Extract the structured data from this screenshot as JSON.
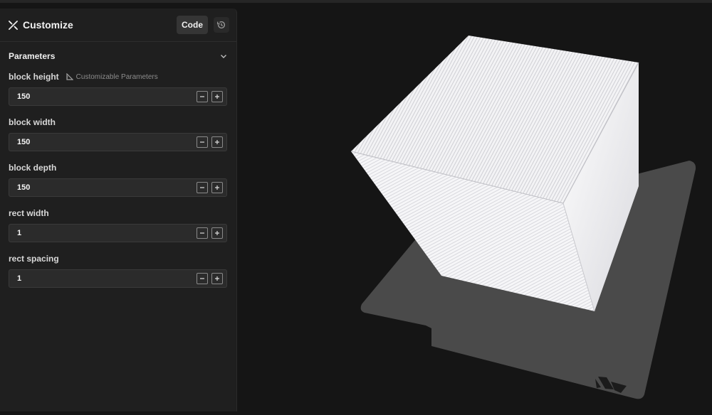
{
  "header": {
    "title": "Customize",
    "code_label": "Code",
    "icons": {
      "title": "wand-ruler-icon",
      "history": "history-icon"
    }
  },
  "parameters": {
    "section_title": "Parameters",
    "hint": "Customizable Parameters",
    "items": [
      {
        "label": "block height",
        "value": "150"
      },
      {
        "label": "block width",
        "value": "150"
      },
      {
        "label": "block depth",
        "value": "150"
      },
      {
        "label": "rect width",
        "value": "1"
      },
      {
        "label": "rect spacing",
        "value": "1"
      }
    ]
  },
  "colors": {
    "background": "#151515",
    "panel": "#1f1f1f",
    "field": "#2b2b2b",
    "build_plate": "#4a4a4a",
    "model": "#f4f4f6"
  }
}
